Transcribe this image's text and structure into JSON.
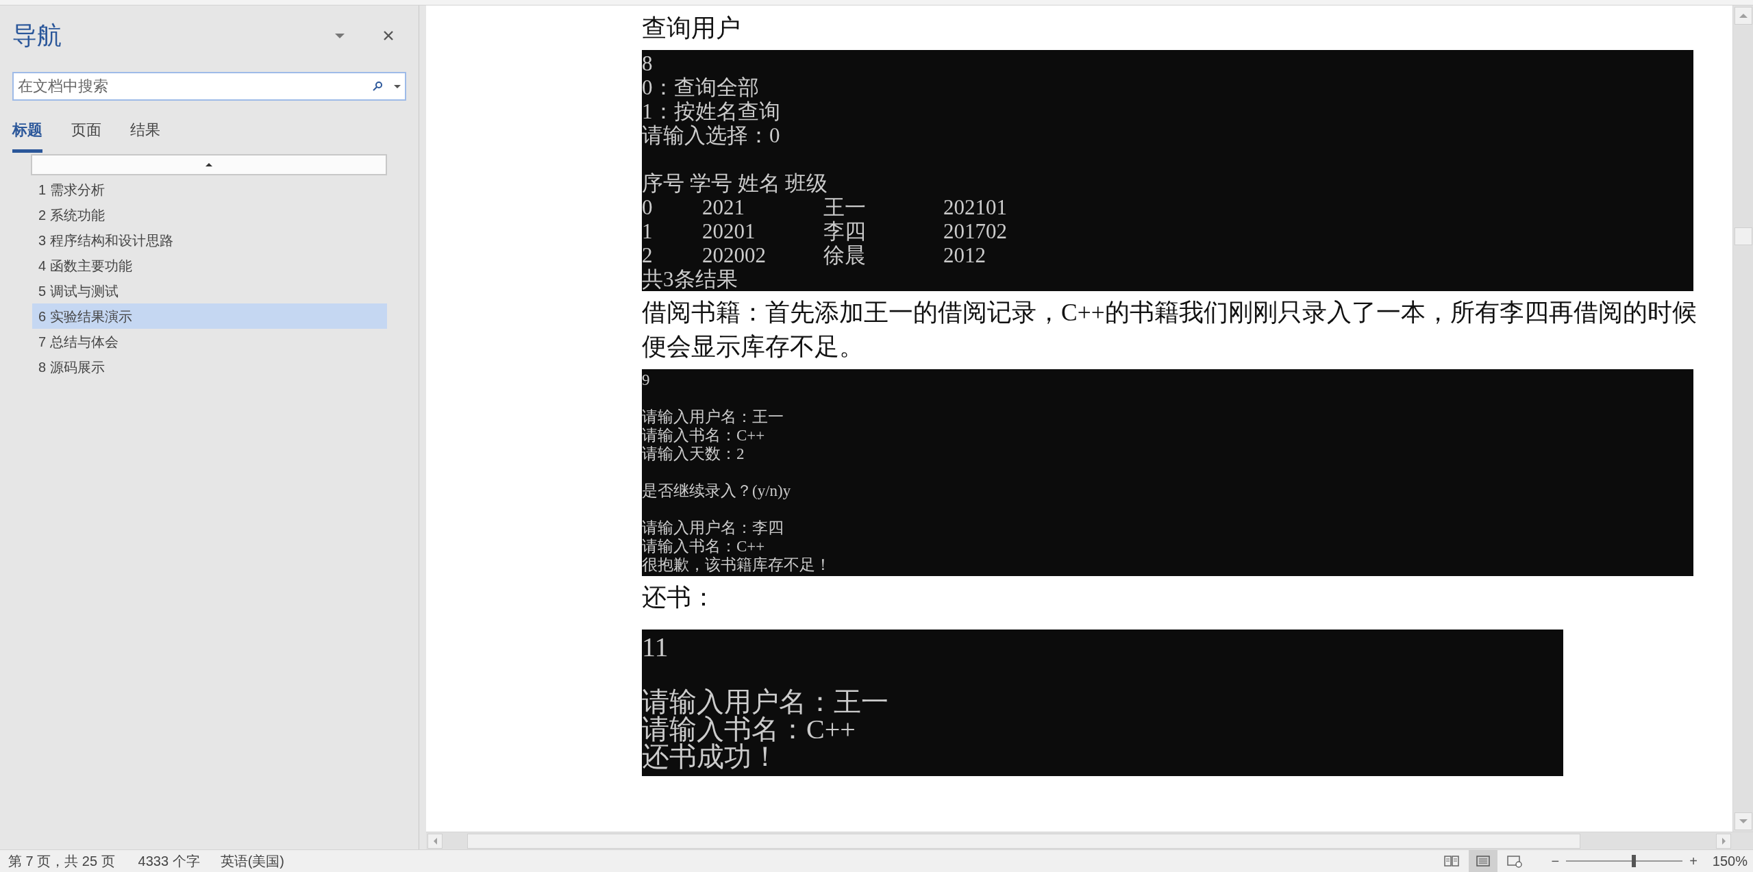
{
  "navigation": {
    "title": "导航",
    "search": {
      "placeholder": "在文档中搜索"
    },
    "tabs": [
      {
        "label": "标题",
        "selected": true
      },
      {
        "label": "页面",
        "selected": false
      },
      {
        "label": "结果",
        "selected": false
      }
    ],
    "headings": [
      {
        "label": "1 需求分析",
        "selected": false
      },
      {
        "label": "2 系统功能",
        "selected": false
      },
      {
        "label": "3 程序结构和设计思路",
        "selected": false
      },
      {
        "label": "4 函数主要功能",
        "selected": false
      },
      {
        "label": "5 调试与测试",
        "selected": false
      },
      {
        "label": "6 实验结果演示",
        "selected": true
      },
      {
        "label": "7 总结与体会",
        "selected": false
      },
      {
        "label": "8 源码展示",
        "selected": false
      }
    ]
  },
  "document": {
    "blocks": [
      {
        "kind": "paragraph",
        "text": "查询用户"
      },
      {
        "kind": "console",
        "lines": [
          {
            "kind": "text",
            "text": "8"
          },
          {
            "kind": "text",
            "text": "0：查询全部"
          },
          {
            "kind": "text",
            "text": "1：按姓名查询"
          },
          {
            "kind": "text",
            "text": "请输入选择：0"
          },
          {
            "kind": "blank"
          },
          {
            "kind": "text",
            "text": "序号 学号 姓名 班级"
          },
          {
            "kind": "row",
            "cells": [
              "0",
              "2021",
              "王一",
              "202101"
            ]
          },
          {
            "kind": "row",
            "cells": [
              "1",
              "20201",
              "李四",
              "201702"
            ]
          },
          {
            "kind": "row",
            "cells": [
              "2",
              "202002",
              "徐晨",
              "2012"
            ]
          },
          {
            "kind": "text",
            "text": "共3条结果"
          }
        ]
      },
      {
        "kind": "paragraph",
        "text": "借阅书籍：首先添加王一的借阅记录，C++的书籍我们刚刚只录入了一本，所有李四再借阅的时候便会显示库存不足。"
      },
      {
        "kind": "console",
        "lines": [
          {
            "kind": "text",
            "text": "9"
          },
          {
            "kind": "blank"
          },
          {
            "kind": "text",
            "text": "请输入用户名：王一"
          },
          {
            "kind": "text",
            "text": "请输入书名：C++"
          },
          {
            "kind": "text",
            "text": "请输入天数：2"
          },
          {
            "kind": "blank"
          },
          {
            "kind": "text",
            "text": "是否继续录入？(y/n)y"
          },
          {
            "kind": "blank"
          },
          {
            "kind": "text",
            "text": "请输入用户名：李四"
          },
          {
            "kind": "text",
            "text": "请输入书名：C++"
          },
          {
            "kind": "text",
            "text": "很抱歉，该书籍库存不足！"
          }
        ]
      },
      {
        "kind": "paragraph",
        "text": "还书："
      },
      {
        "kind": "console",
        "lines": [
          {
            "kind": "text",
            "text": "11"
          },
          {
            "kind": "blank"
          },
          {
            "kind": "text",
            "text": "请输入用户名：王一"
          },
          {
            "kind": "text",
            "text": "请输入书名：C++"
          },
          {
            "kind": "text",
            "text": "还书成功！"
          }
        ]
      }
    ]
  },
  "status_bar": {
    "page": "第 7 页，共 25 页",
    "words": "4333 个字",
    "language": "英语(美国)",
    "views": [
      {
        "kind": "read",
        "selected": false
      },
      {
        "kind": "print",
        "selected": true
      },
      {
        "kind": "web",
        "selected": false
      }
    ],
    "zoom": {
      "minus": "−",
      "plus": "+",
      "level": 0.58,
      "reading": "150%"
    }
  }
}
